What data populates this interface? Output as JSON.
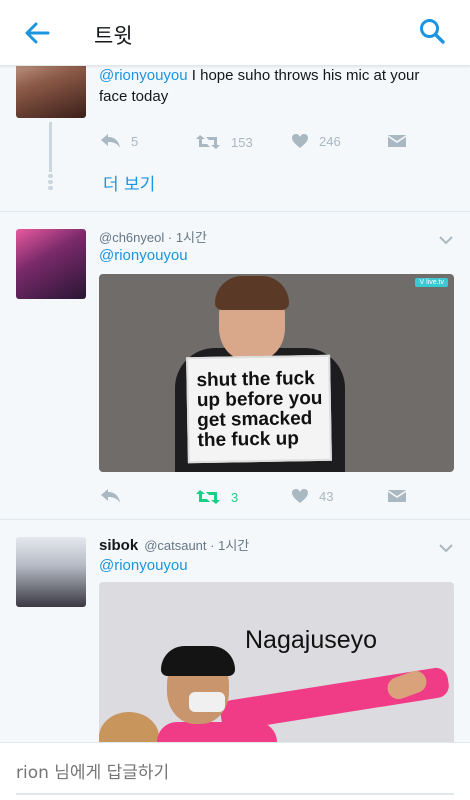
{
  "header": {
    "title": "트윗",
    "back_icon": "arrow-left-icon",
    "search_icon": "search-icon",
    "accent": "#1b95e0"
  },
  "tweets": [
    {
      "mention": "@rionyouyou",
      "text": " I hope suho throws his mic at your face today",
      "actions": {
        "reply": "5",
        "retweet": "153",
        "like": "246"
      },
      "show_more": "더 보기"
    },
    {
      "handle": "@ch6nyeol",
      "time": "· 1시간",
      "reply_to": "@rionyouyou",
      "image_caption": "shut the fuck up before you get smacked the fuck up",
      "image_watermark": "V live.tv",
      "actions": {
        "reply": "",
        "retweet": "3",
        "like": "43"
      },
      "retweeted": true
    },
    {
      "name": "sibok",
      "handle": "@catsaunt",
      "time": "· 1시간",
      "reply_to": "@rionyouyou",
      "image_caption": "Nagajuseyo"
    }
  ],
  "composer": {
    "placeholder": "rion 님에게 답글하기"
  },
  "colors": {
    "retweet_active": "#19cf86",
    "icon_gray": "#aab8c2",
    "link": "#1b95e0"
  }
}
